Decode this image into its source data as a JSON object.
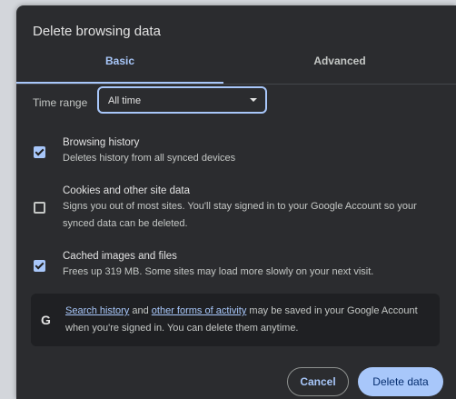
{
  "dialog": {
    "title": "Delete browsing data",
    "tabs": [
      {
        "label": "Basic",
        "selected": true
      },
      {
        "label": "Advanced",
        "selected": false
      }
    ],
    "time_range": {
      "label": "Time range",
      "value": "All time"
    },
    "options": [
      {
        "title": "Browsing history",
        "description": "Deletes history from all synced devices",
        "checked": true
      },
      {
        "title": "Cookies and other site data",
        "description": "Signs you out of most sites. You'll stay signed in to your Google Account so your synced data can be deleted.",
        "checked": false
      },
      {
        "title": "Cached images and files",
        "description": "Frees up 319 MB. Some sites may load more slowly on your next visit.",
        "checked": true
      }
    ],
    "notice": {
      "icon": "google-g-icon",
      "link1": "Search history",
      "and": "and",
      "link2": "other forms of activity",
      "rest": "may be saved in your Google Account when you're signed in. You can delete them anytime."
    },
    "buttons": {
      "cancel": "Cancel",
      "delete": "Delete data"
    }
  },
  "colors": {
    "dialog_bg": "#2b2c2f",
    "accent": "#a8c7fa"
  }
}
